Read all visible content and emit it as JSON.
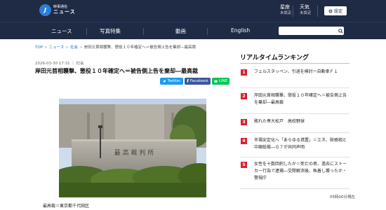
{
  "header": {
    "logo_mark": "J",
    "logo_small": "時事通信",
    "logo_big": "ニュース",
    "weather": [
      {
        "label": "星座",
        "value": "未設定"
      },
      {
        "label": "天気",
        "value": "未設定"
      }
    ],
    "settings_label": "設定"
  },
  "nav": {
    "items": [
      "ニュース",
      "写真特集",
      "動画",
      "English"
    ],
    "search_placeholder": ""
  },
  "breadcrumb": {
    "items": [
      "TOP",
      "ニュース",
      "社会"
    ],
    "current": "岸田元首相襲撃、懲役１０年確定へ＝被告側上告を棄却―最高裁"
  },
  "article": {
    "meta": "2026-03-30 17:31 ｜ 社会",
    "title": "岸田元首相襲撃、懲役１０年確定へ＝被告側上告を棄却―最高裁",
    "share": {
      "twitter": "Twitter",
      "facebook": "Facebook",
      "line": "LINE"
    },
    "photo_caption": "最高裁＝東京都千代田区",
    "building_sign": "最 高 裁 判 所"
  },
  "ranking": {
    "title": "リアルタイムランキング",
    "items": [
      {
        "rank": "1",
        "text": "フェルスタッペン、引退を検討＝自動車Ｆ１"
      },
      {
        "rank": "2",
        "text": "岸田元首相襲撃、懲役１０年確定へ＝被告側上告を棄却―最高裁"
      },
      {
        "rank": "3",
        "text": "敗れた専大松戸　高校野球"
      },
      {
        "rank": "4",
        "text": "市場安定化へ「あらゆる措置」＝エネ、財務相と中銀総裁―Ｇ７が共同声明"
      },
      {
        "rank": "5",
        "text": "女性を十数回刺したか＝死亡の男、過去にストーカー行為で逮捕―交際解消後、執着し襲ったか・警視庁"
      }
    ],
    "updated": "05時00分現在"
  },
  "colors": {
    "header_bg": "#1f2a44",
    "rank_badge": "#d7232f",
    "link": "#1f6fc6"
  }
}
